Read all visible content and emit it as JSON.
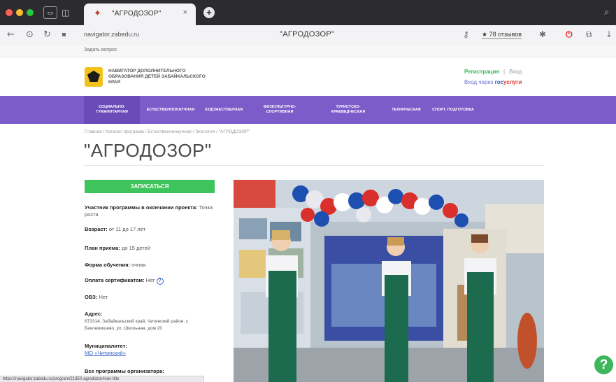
{
  "browser": {
    "tab_title": "\"АГРОДОЗОР\"",
    "tab_close": "×",
    "new_tab": "+",
    "url": "navigator.zabedu.ru",
    "address_title": "\"АГРОДОЗОР\"",
    "reviews_badge": "★ 78 отзывов",
    "bookmarks_label": "Задать вопрос"
  },
  "site": {
    "org_name": "Навигатор дополнительного образования детей Забайкальского края",
    "register": "Регистрация",
    "login": "Вход",
    "gosuslugi_prefix": "Вход через",
    "gosuslugi_gos": "гос",
    "gosuslugi_rest": "услуги"
  },
  "nav": {
    "items": [
      "Социально-гуманитарная",
      "Естественнонаучная",
      "Художественная",
      "Физкультурно-спортивная",
      "Туристско-краеведческая",
      "Техническая",
      "Спорт. подготовка"
    ]
  },
  "breadcrumb": "Главная  /  Каталог программ  /  Естественнонаучная  /  Экология  /  \"АГРОДОЗОР\"",
  "page_title": "\"АГРОДОЗОР\"",
  "enroll_button": "Записаться",
  "info": {
    "participant_label": "Участник программы в окончании проекта:",
    "participant_value": "Точка роста",
    "age_label": "Возраст:",
    "age_value": "от 11 до 17 лет",
    "period_label": "План приема:",
    "period_value": "до 15 детей",
    "form_label": "Форма обучения:",
    "form_value": "очная",
    "payment_label": "Оплата сертификатом:",
    "payment_value": "Нет",
    "help_mark": "?",
    "ovz_label": "ОВЗ:",
    "ovz_value": "Нет",
    "address_label": "Адрес:",
    "address_value": "673314, Забайкальский край, Читинский район, с. Беклемишево, ул. Школьная, дом 20",
    "municipality_label": "Муниципалитет:",
    "municipality_value": "МО «Читинский»",
    "all_programs_label": "Все программы организатора:"
  },
  "status_url": "https://navigator.zabedu.ru/program/21350-agrodozor#nav-title",
  "help_button": "?"
}
